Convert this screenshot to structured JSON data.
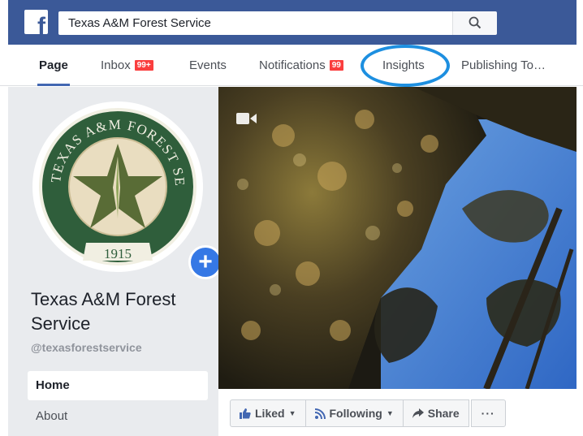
{
  "header": {
    "logo": "f",
    "search_value": "Texas A&M Forest Service",
    "icons": {
      "logo": "facebook-f-icon",
      "search": "magnifier-icon"
    },
    "colors": {
      "brand": "#3b5998",
      "accent": "#4267b2",
      "badge": "#fa3e3e",
      "annotation": "#1d8fe0"
    }
  },
  "tabs": [
    {
      "label": "Page",
      "badge": ""
    },
    {
      "label": "Inbox",
      "badge": "99+"
    },
    {
      "label": "Events",
      "badge": ""
    },
    {
      "label": "Notifications",
      "badge": "99"
    },
    {
      "label": "Insights",
      "badge": ""
    },
    {
      "label": "Publishing To…",
      "badge": ""
    }
  ],
  "profile": {
    "logo_top_text": "TEXAS A&M FOREST SERVICE",
    "logo_year": "1915",
    "name": "Texas A&M Forest Service",
    "handle": "@texasforestservice",
    "add_icon": "plus-icon"
  },
  "nav": [
    {
      "label": "Home"
    },
    {
      "label": "About"
    }
  ],
  "cover": {
    "icon": "video-camera-icon"
  },
  "actions": {
    "liked": "Liked",
    "following": "Following",
    "share": "Share",
    "more": "···"
  }
}
